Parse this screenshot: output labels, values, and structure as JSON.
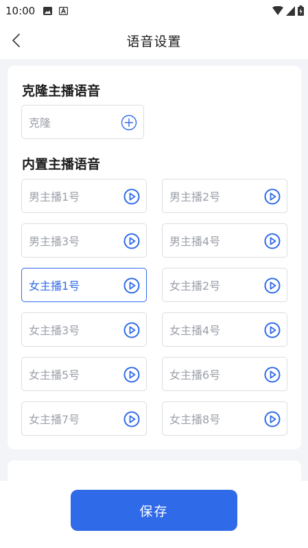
{
  "status_bar": {
    "time": "10:00",
    "left_icons": [
      "image-icon",
      "a-box-icon"
    ],
    "right_icons": [
      "wifi-icon",
      "signal-icon",
      "battery-icon"
    ]
  },
  "header": {
    "back_icon": "chevron-left-icon",
    "title": "语音设置"
  },
  "clone_section": {
    "title": "克隆主播语音",
    "clone_label": "克隆",
    "add_icon": "plus-circle-icon"
  },
  "builtin_section": {
    "title": "内置主播语音",
    "play_icon": "play-circle-icon",
    "voices": [
      {
        "label": "男主播1号",
        "selected": false
      },
      {
        "label": "男主播2号",
        "selected": false
      },
      {
        "label": "男主播3号",
        "selected": false
      },
      {
        "label": "男主播4号",
        "selected": false
      },
      {
        "label": "女主播1号",
        "selected": true
      },
      {
        "label": "女主播2号",
        "selected": false
      },
      {
        "label": "女主播3号",
        "selected": false
      },
      {
        "label": "女主播4号",
        "selected": false
      },
      {
        "label": "女主播5号",
        "selected": false
      },
      {
        "label": "女主播6号",
        "selected": false
      },
      {
        "label": "女主播7号",
        "selected": false
      },
      {
        "label": "女主播8号",
        "selected": false
      }
    ]
  },
  "footer": {
    "save_label": "保存"
  },
  "colors": {
    "accent": "#2F6AE9",
    "border": "#DADDE2",
    "muted_text": "#9A9FA8",
    "background": "#F2F4F7"
  }
}
